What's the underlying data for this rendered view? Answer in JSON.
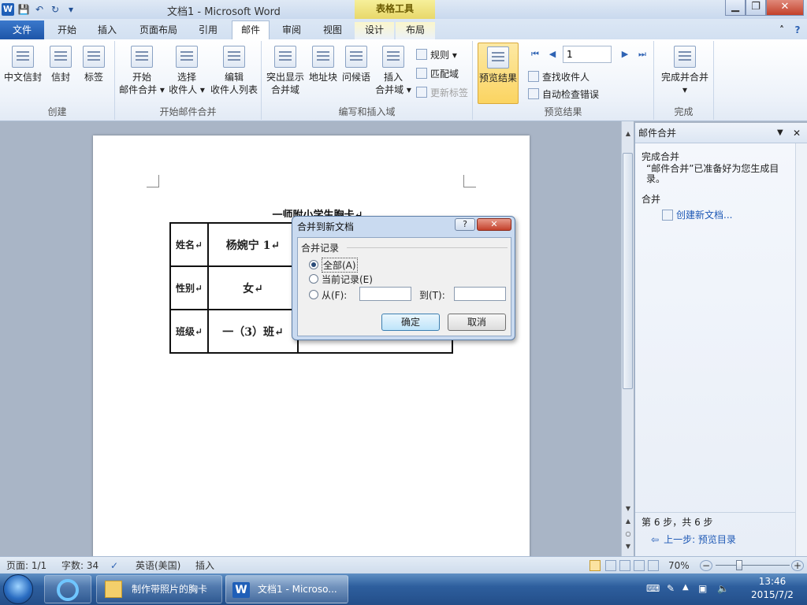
{
  "window": {
    "title": "文档1 - Microsoft Word",
    "context_tab_group": "表格工具",
    "controls": {
      "minimize": "▁",
      "restore": "❐",
      "close": "✕"
    }
  },
  "qat": {
    "word_icon": "W",
    "save_icon": "💾",
    "undo_icon": "↶",
    "redo_icon": "↻",
    "dropdown_icon": "▾"
  },
  "tabs": {
    "file": "文件",
    "home": "开始",
    "insert": "插入",
    "page_layout": "页面布局",
    "references": "引用",
    "mailings": "邮件",
    "review": "审阅",
    "view": "视图",
    "design": "设计",
    "layout": "布局",
    "help_icon": "?",
    "collapse_icon": "˄"
  },
  "ribbon": {
    "create": {
      "label": "创建",
      "envelopes_cn": "中文信封",
      "envelopes": "信封",
      "labels": "标签"
    },
    "start_merge": {
      "label": "开始邮件合并",
      "start_line1": "开始",
      "start_line2": "邮件合并 ▾",
      "select_line1": "选择",
      "select_line2": "收件人 ▾",
      "edit_line1": "编辑",
      "edit_line2": "收件人列表"
    },
    "write_insert": {
      "label": "编写和插入域",
      "highlight_line1": "突出显示",
      "highlight_line2": "合并域",
      "address_block": "地址块",
      "greeting_line": "问候语",
      "insert_line1": "插入",
      "insert_line2": "合并域 ▾",
      "rules": "规则 ▾",
      "match_fields": "匹配域",
      "update_labels": "更新标签"
    },
    "preview": {
      "label": "预览结果",
      "preview_results": "预览结果",
      "record_number": "1",
      "find_recipient": "查找收件人",
      "auto_check": "自动检查错误",
      "nav_first": "⏮",
      "nav_prev": "◀",
      "nav_next": "▶",
      "nav_last": "⏭"
    },
    "finish": {
      "label": "完成",
      "finish_merge": "完成并合并",
      "finish_merge_arrow": "▾"
    }
  },
  "document": {
    "heading": "一师附小学生胸卡↵",
    "rows": [
      {
        "label": "姓名↵",
        "value": "杨婉宁 1↵"
      },
      {
        "label": "性别↵",
        "value": "女↵"
      },
      {
        "label": "班级↵",
        "value": "一（3）班↵"
      }
    ]
  },
  "dialog": {
    "title": "合并到新文档",
    "help": "?",
    "close": "✕",
    "group_label": "合并记录",
    "opt_all": "全部(A)",
    "opt_current": "当前记录(E)",
    "opt_from": "从(F):",
    "to_label": "到(T):",
    "from_value": "",
    "to_value": "",
    "ok": "确定",
    "cancel": "取消"
  },
  "task_pane": {
    "title": "邮件合并",
    "menu_icon": "▼",
    "close_icon": "✕",
    "section1_title": "完成合并",
    "section1_text": "“邮件合并”已准备好为您生成目录。",
    "section2_title": "合并",
    "create_new_doc": "创建新文档...",
    "step_text": "第 6 步，共 6 步",
    "prev_step": "上一步: 预览目录"
  },
  "statusbar": {
    "page": "页面: 1/1",
    "words": "字数: 34",
    "language": "英语(美国)",
    "insert_mode": "插入",
    "zoom": "70%",
    "zoom_minus": "−",
    "zoom_plus": "+"
  },
  "taskbar": {
    "folder_window": "制作带照片的胸卡",
    "word_window": "文档1 - Microso...",
    "time": "13:46",
    "date": "2015/7/2"
  }
}
